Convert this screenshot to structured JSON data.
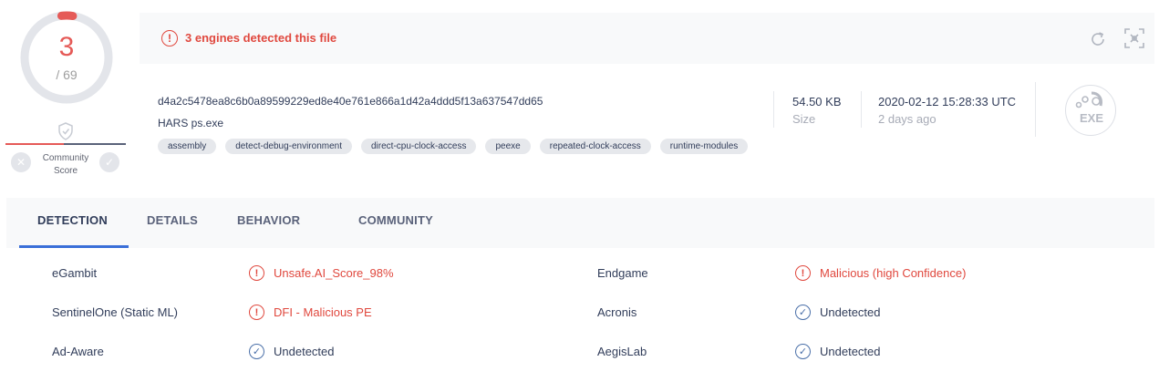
{
  "score": {
    "detections": "3",
    "total": "/ 69",
    "community_label": "Community Score",
    "colors": {
      "detected": "#e55a57",
      "ring": "#e3e5ea"
    },
    "detection_ratio": 0.0435
  },
  "alert": {
    "text": "3 engines detected this file",
    "icon": "alert-circle-icon",
    "color": "#e0483e"
  },
  "file": {
    "hash": "d4a2c5478ea8c6b0a89599229ed8e40e761e866a1d42a4ddd5f13a637547dd65",
    "name": "HARS ps.exe",
    "tags": [
      "assembly",
      "detect-debug-environment",
      "direct-cpu-clock-access",
      "peexe",
      "repeated-clock-access",
      "runtime-modules"
    ],
    "size_value": "54.50 KB",
    "size_label": "Size",
    "date_value": "2020-02-12 15:28:33 UTC",
    "date_label": "2 days ago",
    "type_label": "EXE"
  },
  "tabs": [
    {
      "label": "DETECTION",
      "active": true
    },
    {
      "label": "DETAILS",
      "active": false
    },
    {
      "label": "BEHAVIOR",
      "active": false
    },
    {
      "label": "COMMUNITY",
      "active": false
    }
  ],
  "detections": [
    {
      "left_engine": "eGambit",
      "left_result": "Unsafe.AI_Score_98%",
      "left_status": "malicious",
      "right_engine": "Endgame",
      "right_result": "Malicious (high Confidence)",
      "right_status": "malicious"
    },
    {
      "left_engine": "SentinelOne (Static ML)",
      "left_result": "DFI - Malicious PE",
      "left_status": "malicious",
      "right_engine": "Acronis",
      "right_result": "Undetected",
      "right_status": "undetected"
    },
    {
      "left_engine": "Ad-Aware",
      "left_result": "Undetected",
      "left_status": "undetected",
      "right_engine": "AegisLab",
      "right_result": "Undetected",
      "right_status": "undetected"
    }
  ]
}
